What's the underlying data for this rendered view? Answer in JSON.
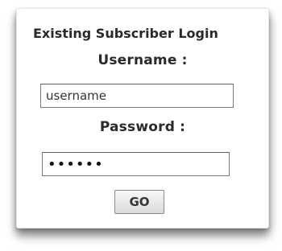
{
  "login": {
    "title": "Existing Subscriber Login",
    "username_label": "Username :",
    "username_value": "username",
    "password_label": "Password :",
    "password_value": "••••••",
    "submit_label": "GO"
  }
}
